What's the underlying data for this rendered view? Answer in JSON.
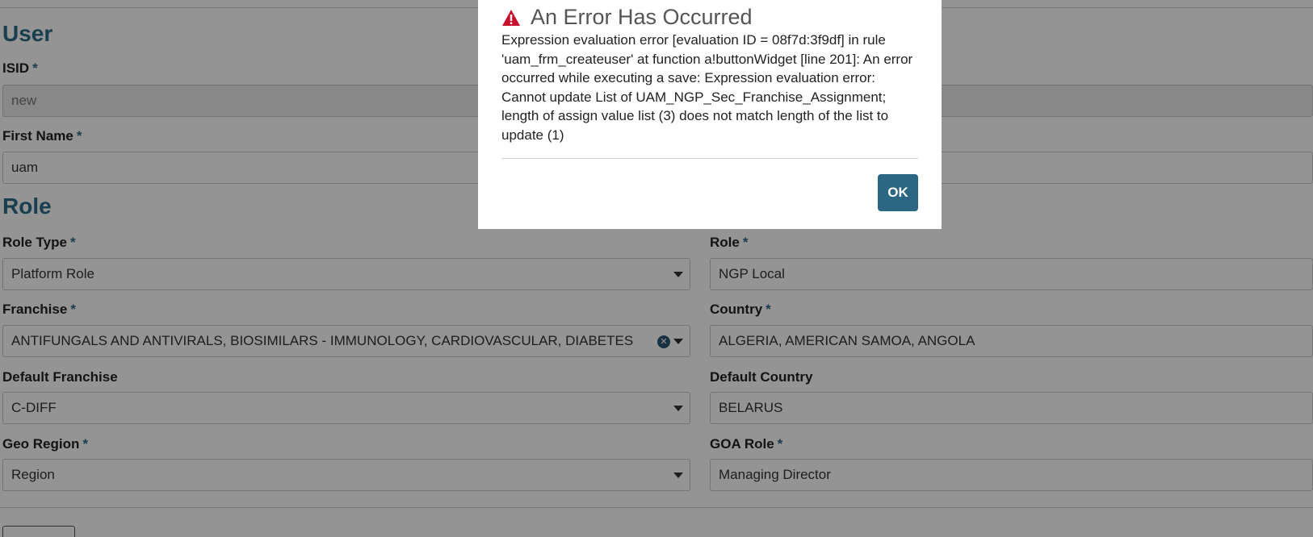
{
  "user_section": {
    "title": "User",
    "isid": {
      "label": "ISID",
      "value": "new"
    },
    "first_name": {
      "label": "First Name",
      "value": "uam"
    }
  },
  "role_section": {
    "title": "Role",
    "role_type": {
      "label": "Role Type",
      "value": "Platform Role"
    },
    "role": {
      "label": "Role",
      "value": "NGP Local"
    },
    "franchise": {
      "label": "Franchise",
      "value": "ANTIFUNGALS AND ANTIVIRALS, BIOSIMILARS - IMMUNOLOGY, CARDIOVASCULAR, DIABETES"
    },
    "country": {
      "label": "Country",
      "value": "ALGERIA, AMERICAN SAMOA, ANGOLA"
    },
    "default_franchise": {
      "label": "Default Franchise",
      "value": "C-DIFF"
    },
    "default_country": {
      "label": "Default Country",
      "value": "BELARUS"
    },
    "geo_region": {
      "label": "Geo Region",
      "value": "Region"
    },
    "goa_role": {
      "label": "GOA Role",
      "value": "Managing Director"
    }
  },
  "required_marker": "*",
  "dialog": {
    "title": "An Error Has Occurred",
    "message": "Expression evaluation error [evaluation ID = 08f7d:3f9df] in rule 'uam_frm_createuser' at function a!buttonWidget [line 201]: An error occurred while executing a save: Expression evaluation error: Cannot update List of UAM_NGP_Sec_Franchise_Assignment; length of assign value list (3) does not match length of the list to update (1)",
    "ok_label": "OK",
    "icon": "warning-icon"
  },
  "colors": {
    "accent": "#2e6b87",
    "button": "#2b6683",
    "warning": "#c8102e"
  }
}
